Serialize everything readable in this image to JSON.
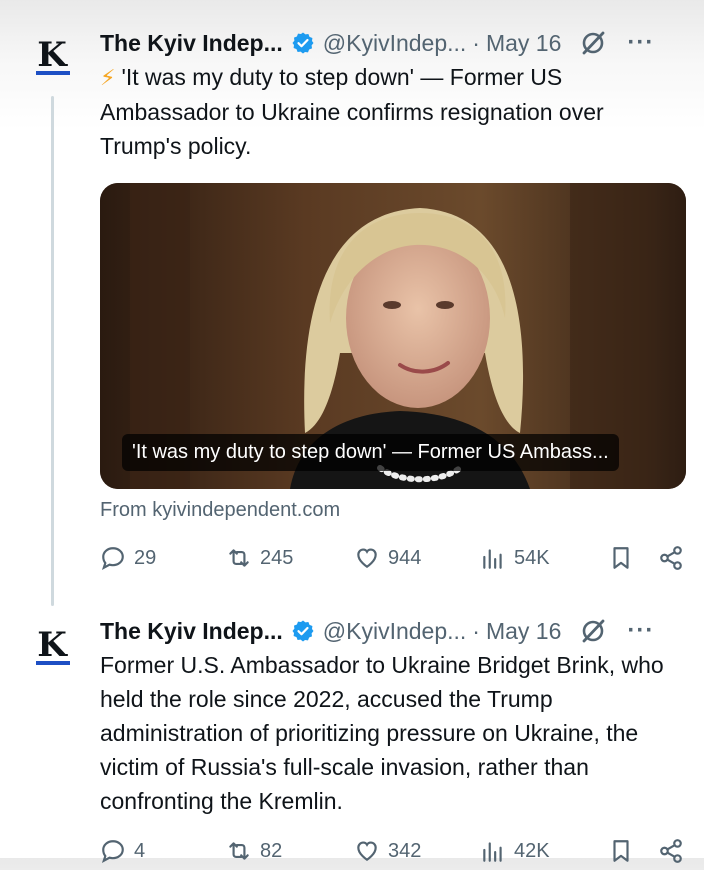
{
  "tweets": [
    {
      "avatar_letter": "K",
      "name": "The Kyiv Indep...",
      "handle": "@KyivIndep...",
      "separator": "·",
      "date": "May 16",
      "more": "···",
      "bolt": "⚡",
      "text": "'It was my duty to step down' — Former US Ambassador to Ukraine confirms resignation over Trump's policy.",
      "card": {
        "caption": "'It was my duty to step down' — Former US Ambass...",
        "source": "From kyivindependent.com"
      },
      "stats": {
        "replies": "29",
        "retweets": "245",
        "likes": "944",
        "views": "54K"
      }
    },
    {
      "avatar_letter": "K",
      "name": "The Kyiv Indep...",
      "handle": "@KyivIndep...",
      "separator": "·",
      "date": "May 16",
      "more": "···",
      "text": "Former U.S. Ambassador to Ukraine Bridget Brink, who held the role since 2022, accused the Trump administration of prioritizing pressure on Ukraine, the victim of Russia's full-scale invasion, rather than confronting the Kremlin.",
      "stats": {
        "replies": "4",
        "retweets": "82",
        "likes": "342",
        "views": "42K"
      }
    }
  ],
  "colors": {
    "accent": "#1d9bf0",
    "muted": "#536471",
    "brand_underline": "#1d4fc4",
    "bolt": "#f5a623"
  }
}
